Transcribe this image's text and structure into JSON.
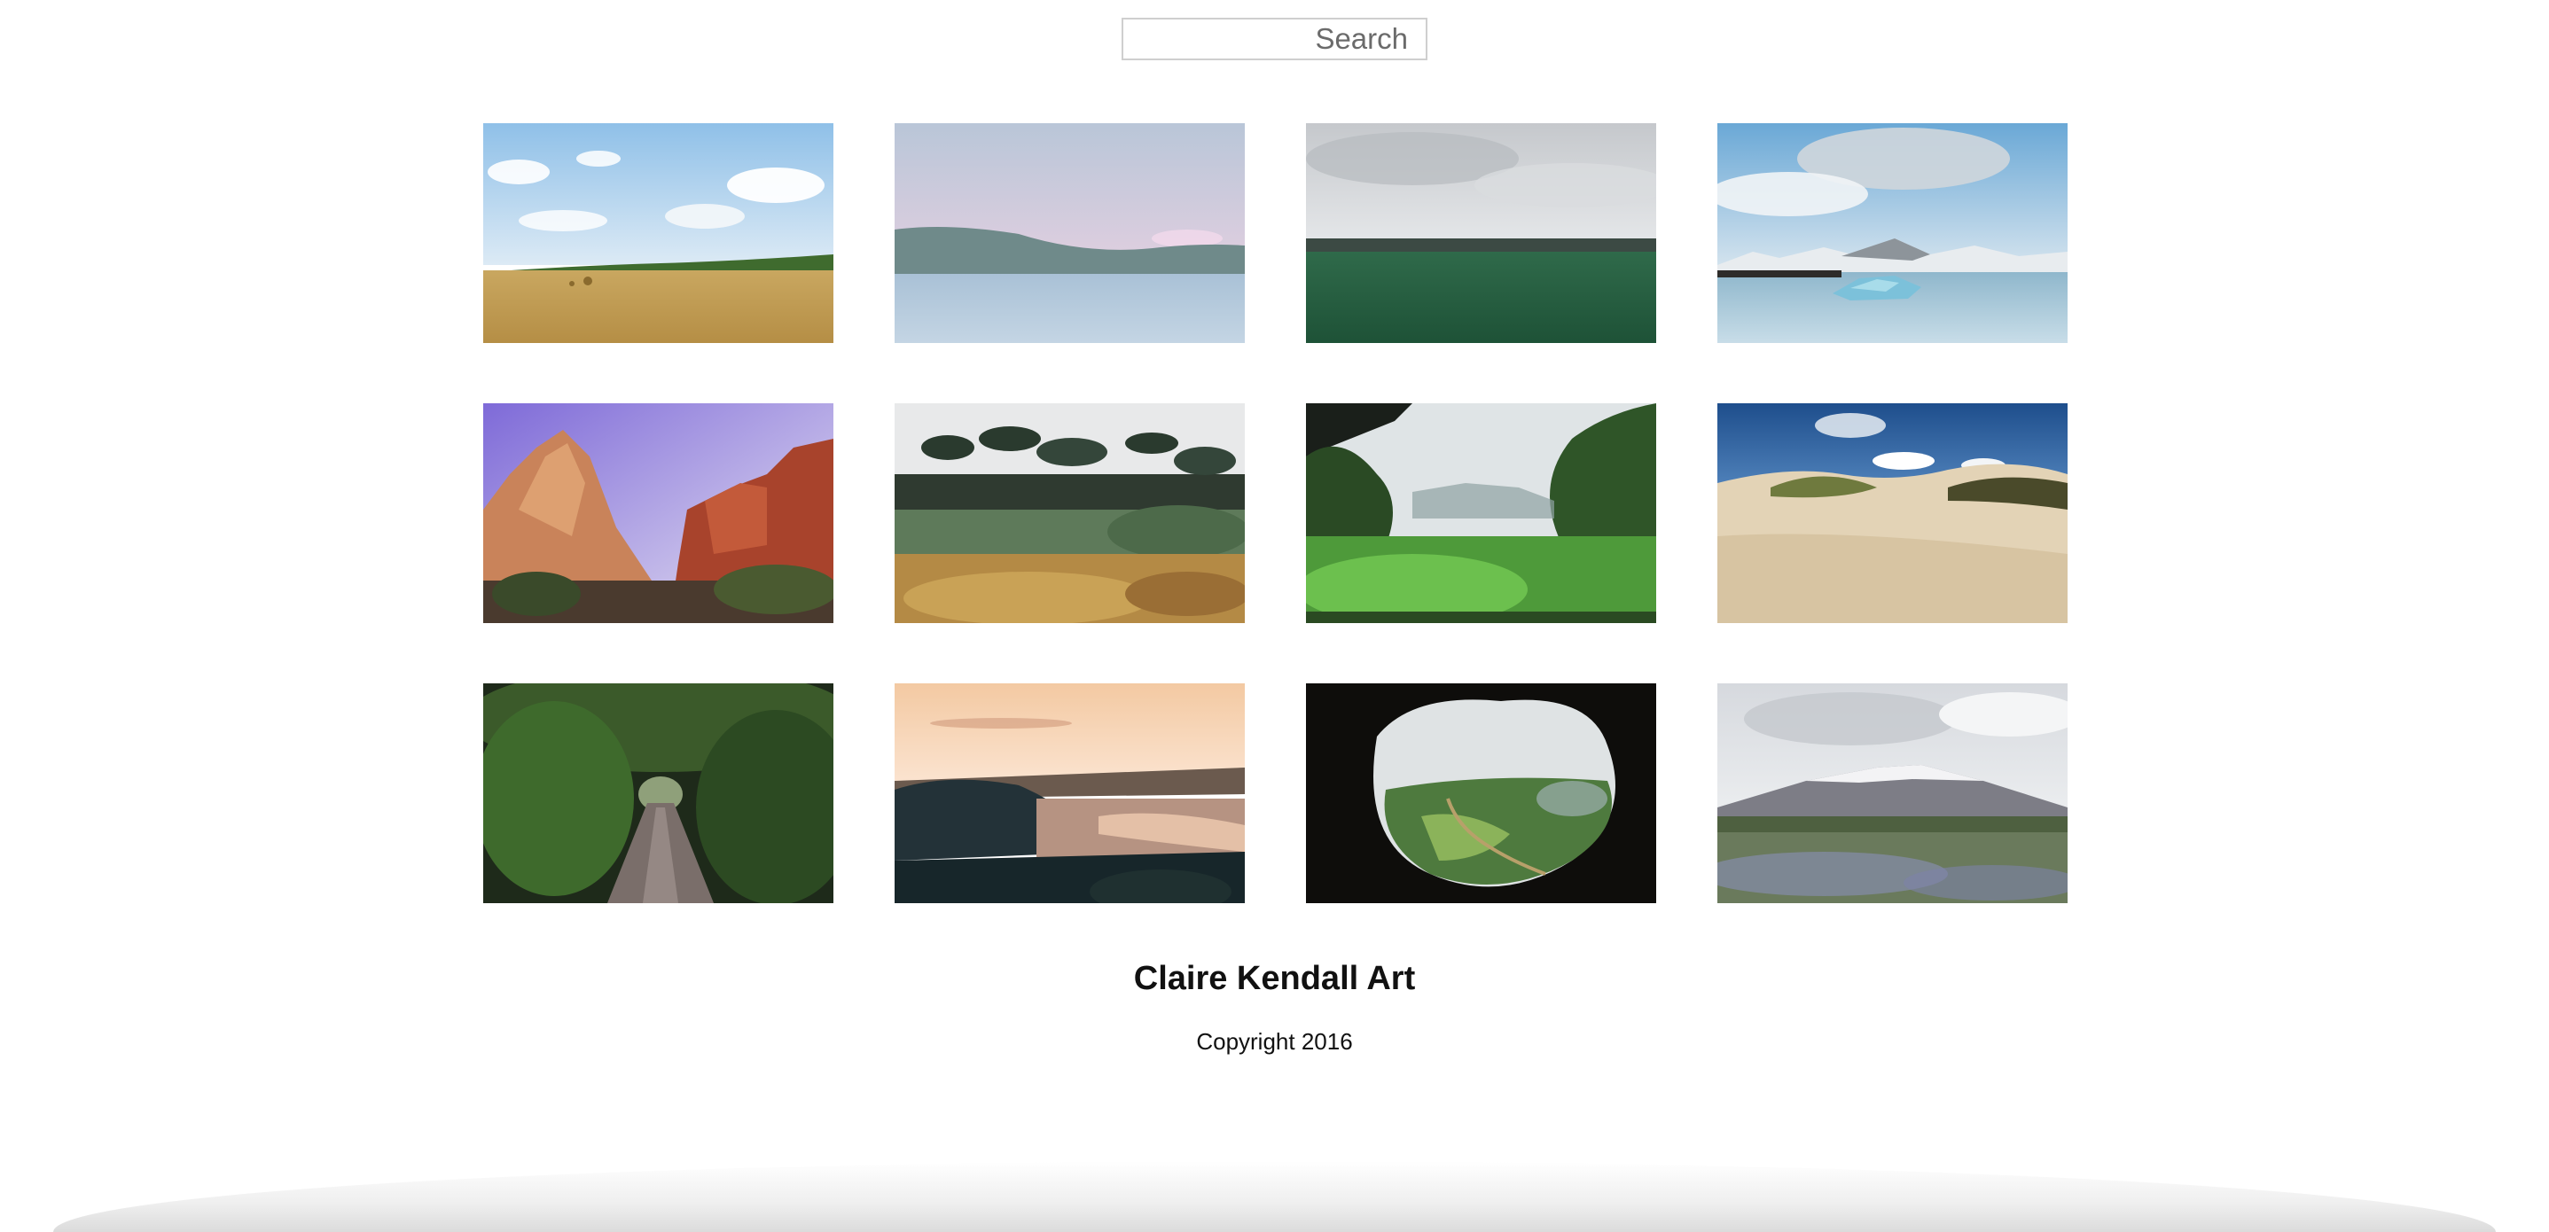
{
  "search": {
    "placeholder": "Search",
    "value": ""
  },
  "gallery": {
    "photos": [
      {
        "subject": "golden hay field under blue sky with clouds"
      },
      {
        "subject": "calm lake with pastel pink sky and distant hills"
      },
      {
        "subject": "green field under overcast grey sky"
      },
      {
        "subject": "icebergs floating in lagoon with snowy mountains"
      },
      {
        "subject": "red rock canyon cliffs under purple sky"
      },
      {
        "subject": "bonsai-like trees over autumn meadow"
      },
      {
        "subject": "lush green valley framed by foliage"
      },
      {
        "subject": "sand dunes with grass under blue sky"
      },
      {
        "subject": "tree tunnel over a narrow country road"
      },
      {
        "subject": "coastal cliffs at sunset with peach sky"
      },
      {
        "subject": "view from cave opening onto green valley"
      },
      {
        "subject": "lupine field with snow-capped mountain"
      }
    ]
  },
  "footer": {
    "title": "Claire Kendall Art",
    "copyright": "Copyright 2016"
  }
}
